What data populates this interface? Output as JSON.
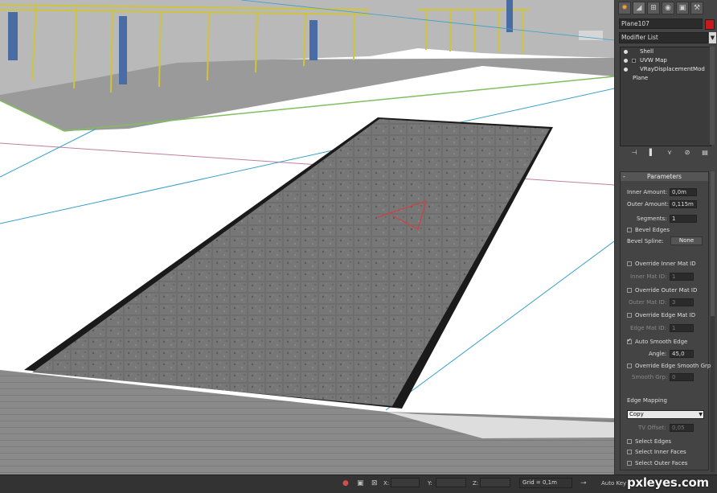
{
  "panel": {
    "tabs": [
      {
        "icon": "create-sun-icon",
        "glyph": "✹"
      },
      {
        "icon": "modify-icon",
        "glyph": "◢"
      },
      {
        "icon": "hierarchy-icon",
        "glyph": "⊞"
      },
      {
        "icon": "motion-icon",
        "glyph": "◉"
      },
      {
        "icon": "display-icon",
        "glyph": "▣"
      },
      {
        "icon": "utilities-hammer-icon",
        "glyph": "⚒"
      }
    ],
    "object_name": "Plane107",
    "object_color": "#c81a1a",
    "modifier_list_label": "Modifier List",
    "stack": [
      {
        "label": "Shell",
        "expandable": false
      },
      {
        "label": "UVW Map",
        "expandable": true
      },
      {
        "label": "VRayDisplacementMod",
        "expandable": false
      },
      {
        "label": "Plane",
        "base": true
      }
    ],
    "stack_tools": {
      "pin": "⊣",
      "show_end": "▌",
      "make_unique": "⋎",
      "remove": "⊘",
      "configure": "▤"
    },
    "params": {
      "header": "Parameters",
      "collapse": "-",
      "inner_amount_label": "Inner Amount:",
      "inner_amount": "0,0m",
      "outer_amount_label": "Outer Amount:",
      "outer_amount": "0,115m",
      "segments_label": "Segments:",
      "segments": "1",
      "bevel_edges_label": "Bevel Edges",
      "bevel_spline_label": "Bevel Spline:",
      "bevel_spline_value": "None",
      "override_inner_label": "Override Inner Mat ID",
      "inner_mat_id_label": "Inner Mat ID:",
      "inner_mat_id": "1",
      "override_outer_label": "Override Outer Mat ID",
      "outer_mat_id_label": "Outer Mat ID:",
      "outer_mat_id": "3",
      "override_edge_label": "Override Edge Mat ID",
      "edge_mat_id_label": "Edge Mat ID:",
      "edge_mat_id": "1",
      "auto_smooth_label": "Auto Smooth Edge",
      "angle_label": "Angle:",
      "angle": "45,0",
      "override_smooth_label": "Override Edge Smooth Grp",
      "smooth_grp_label": "Smooth Grp:",
      "smooth_grp": "0",
      "edge_mapping_label": "Edge Mapping",
      "edge_mapping_value": "Copy",
      "tv_offset_label": "TV Offset:",
      "tv_offset": "0,05",
      "select_edges_label": "Select Edges",
      "select_inner_label": "Select Inner Faces",
      "select_outer_label": "Select Outer Faces"
    }
  },
  "status": {
    "x_label": "X:",
    "y_label": "Y:",
    "z_label": "Z:",
    "grid_text": "Grid = 0,1m",
    "auto_key_label": "Auto Key",
    "icons": {
      "pin": "📍",
      "lock": "🔒",
      "absolute": "⊠",
      "key": "⊸"
    }
  },
  "watermark": "pxleyes.com"
}
